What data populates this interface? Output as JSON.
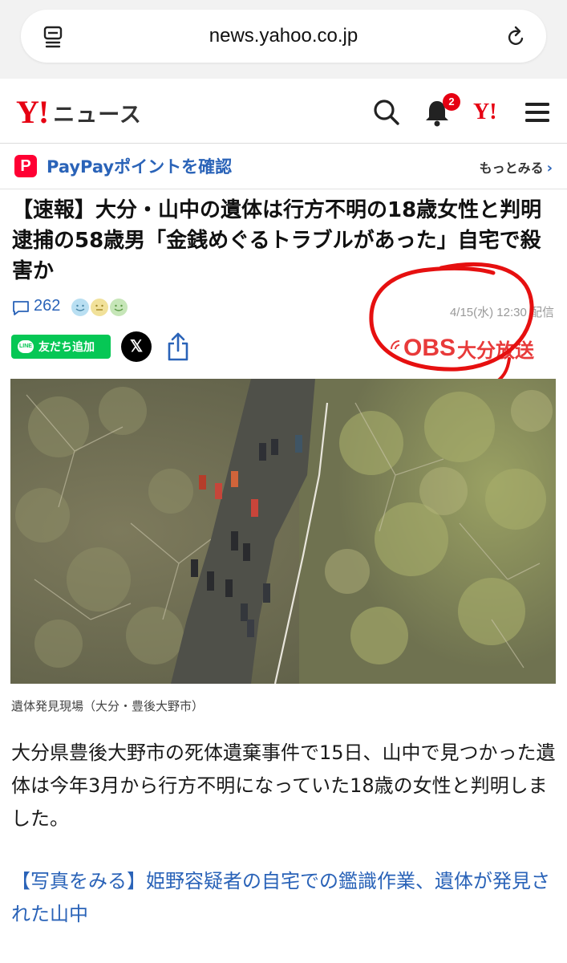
{
  "browser": {
    "url": "news.yahoo.co.jp",
    "icons": [
      "tabs-icon",
      "reload-icon"
    ]
  },
  "header": {
    "logo_mark": "Y!",
    "logo_text": "ニュース",
    "notification_count": "2",
    "yahoo_mark": "Y!",
    "icons": [
      "search-icon",
      "bell-icon",
      "menu-icon"
    ],
    "brand_color": "#e60012"
  },
  "paypay": {
    "icon_letter": "P",
    "label": "PayPayポイントを確認",
    "more_label": "もっとみる",
    "chevron": "›"
  },
  "article": {
    "headline": "【速報】大分・山中の遺体は行方不明の18歳女性と判明　逮捕の58歳男「金銭めぐるトラブルがあった」自宅で殺害か",
    "comment_count": "262",
    "datetime": "4/15(水) 12:30 配信",
    "line_button_label": "友だち追加",
    "line_logo_text": "LINE",
    "x_label": "𝕏",
    "source_logo": "OBS",
    "source_name": "大分放送",
    "photo_caption": "遺体発見現場（大分・豊後大野市）",
    "body": "大分県豊後大野市の死体遺棄事件で15日、山中で見つかった遺体は今年3月から行方不明になっていた18歳の女性と判明しました。",
    "related_link": "【写真をみる】姫野容疑者の自宅での鑑識作業、遺体が発見された山中",
    "link_color": "#2a63b8"
  }
}
